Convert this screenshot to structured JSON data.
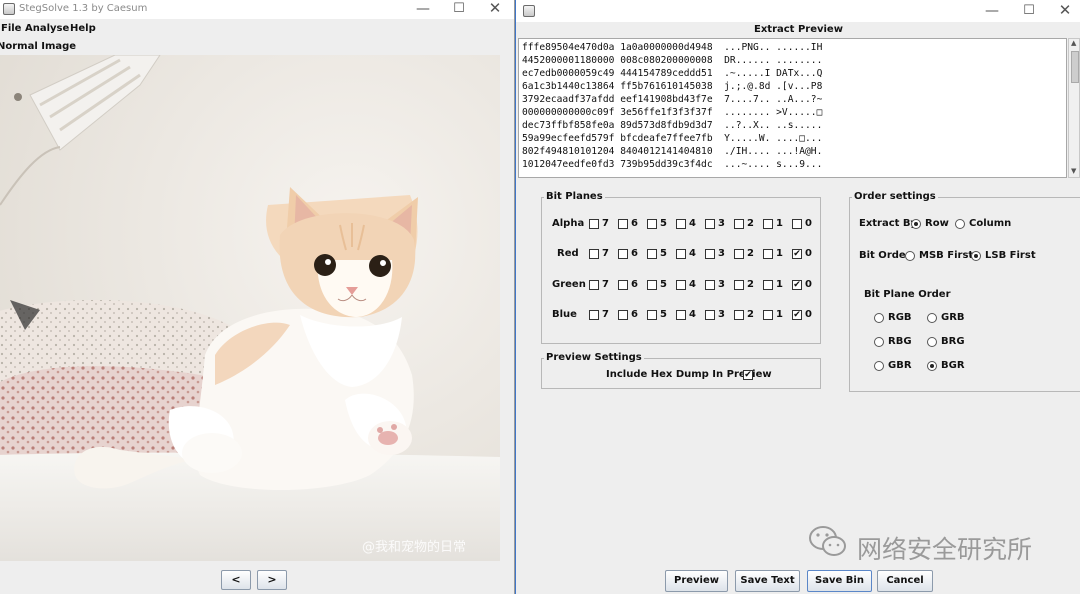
{
  "left_window": {
    "title": "StegSolve 1.3 by Caesum",
    "menu": [
      "File",
      "Analyse",
      "Help"
    ],
    "image_title": "Normal Image",
    "image_watermark": "@我和宠物的日常",
    "prev_label": "<",
    "next_label": ">"
  },
  "right_window": {
    "extract_title": "Extract Preview",
    "hex_lines": [
      "fffe89504e470d0a 1a0a0000000d4948  ...PNG.. ......IH",
      "4452000001180000 008c080200000008  DR...... ........",
      "ec7edb0000059c49 444154789ceddd51  .~.....I DATx...Q",
      "6a1c3b1440c13864 ff5b761610145038  j.;.@.8d .[v...P8",
      "3792ecaadf37afdd eef141908bd43f7e  7....7.. ..A...?~",
      "000000000000c09f 3e56ffe1f3f3f37f  ........ >V.....□",
      "dec73ffbf858fe0a 89d573d8fdb9d3d7  ..?..X.. ..s.....",
      "59a99ecfeefd579f bfcdeafe7ffee7fb  Y.....W. ....□...",
      "802f494810101204 8404012141404810  ./IH.... ...!A@H.",
      "1012047eedfe0fd3 739b95dd39c3f4dc  ...~.... s...9..."
    ],
    "bit_planes": {
      "title": "Bit Planes",
      "bits": [
        "7",
        "6",
        "5",
        "4",
        "3",
        "2",
        "1",
        "0"
      ],
      "rows": [
        {
          "label": "Alpha",
          "checked": []
        },
        {
          "label": "Red",
          "checked": [
            "0"
          ]
        },
        {
          "label": "Green",
          "checked": [
            "0"
          ]
        },
        {
          "label": "Blue",
          "checked": [
            "0"
          ]
        }
      ]
    },
    "preview_settings": {
      "title": "Preview Settings",
      "hex_dump_label": "Include Hex Dump In Preview",
      "hex_dump_checked": true
    },
    "order_settings": {
      "title": "Order settings",
      "extract_by_label": "Extract By",
      "extract_by_options": [
        "Row",
        "Column"
      ],
      "extract_by_selected": "Row",
      "bit_order_label": "Bit Order",
      "bit_order_options": [
        "MSB First",
        "LSB First"
      ],
      "bit_order_selected": "LSB First",
      "bit_plane_order_label": "Bit Plane Order",
      "bit_plane_order_options": [
        "RGB",
        "GRB",
        "RBG",
        "BRG",
        "GBR",
        "BGR"
      ],
      "bit_plane_order_selected": "BGR"
    },
    "buttons": {
      "preview": "Preview",
      "save_text": "Save Text",
      "save_bin": "Save Bin",
      "cancel": "Cancel"
    },
    "watermark": "网络安全研究所"
  },
  "colors": {
    "window_bg": "#eeeeee",
    "focus_border": "#3f76c9"
  }
}
